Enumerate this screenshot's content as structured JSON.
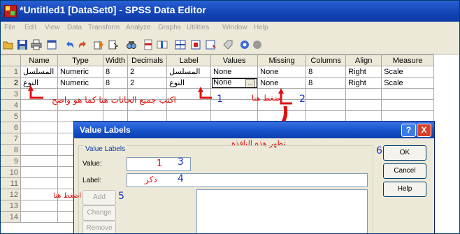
{
  "window": {
    "title": "*Untitled1 [DataSet0] - SPSS Data Editor"
  },
  "menu": [
    "File",
    "Edit",
    "View",
    "Data",
    "Transform",
    "Analyze",
    "Graphs",
    "Utilities",
    "Window",
    "Help"
  ],
  "toolbar_icons": [
    "open-icon",
    "save-icon",
    "print-icon",
    "dialog-recall-icon",
    "undo-icon",
    "redo-icon",
    "goto-case-icon",
    "variables-icon",
    "find-icon",
    "insert-cases-icon",
    "insert-variable-icon",
    "split-file-icon",
    "weight-cases-icon",
    "select-cases-icon",
    "value-labels-icon",
    "use-sets-icon",
    "show-all-icon"
  ],
  "grid": {
    "columns": [
      "Name",
      "Type",
      "Width",
      "Decimals",
      "Label",
      "Values",
      "Missing",
      "Columns",
      "Align",
      "Measure"
    ],
    "row_numbers": [
      "1",
      "2",
      "3",
      "4",
      "5",
      "6",
      "7",
      "8",
      "9",
      "10",
      "11",
      "12",
      "13",
      "14"
    ],
    "rows": [
      {
        "name": "المسلسل",
        "type": "Numeric",
        "width": "8",
        "decimals": "2",
        "label": "المسلسل",
        "values": "None",
        "missing": "None",
        "columns": "8",
        "align": "Right",
        "measure": "Scale"
      },
      {
        "name": "النوع",
        "type": "Numeric",
        "width": "8",
        "decimals": "2",
        "label": "النوع",
        "values": "None",
        "missing": "None",
        "columns": "8",
        "align": "Right",
        "measure": "Scale"
      }
    ]
  },
  "annotations": {
    "write_all_cells": "اكتب جميع الخانات هنا كما هو واضح",
    "num1": "1",
    "press_here": "اضغط هنا",
    "num2": "2",
    "window_appears": "تظهر هذه النافذة",
    "value_num": "1",
    "num3": "3",
    "label_value": "ذكر",
    "num4": "4",
    "press_here_add": "اضغط هنا",
    "num5": "5",
    "num6": "6"
  },
  "dialog": {
    "title": "Value Labels",
    "help": "?",
    "close": "X",
    "group_label": "Value Labels",
    "value_label": "Value:",
    "label_label": "Label:",
    "add": "Add",
    "change": "Change",
    "remove": "Remove",
    "ok": "OK",
    "cancel": "Cancel",
    "help_btn": "Help"
  },
  "colors": {
    "title_bar": "#1446b8",
    "annotation_red": "#e01010",
    "annotation_blue": "#1a30c8",
    "chrome": "#ece9d8"
  }
}
